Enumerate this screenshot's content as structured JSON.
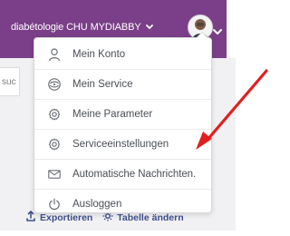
{
  "header": {
    "org_label": "diabétologie CHU MYDIABBY",
    "org_chevron_icon": "chevron-down-icon",
    "avatar_icon": "avatar-icon",
    "avatar_chevron_icon": "chevron-down-icon",
    "background": "#7a3f88"
  },
  "search": {
    "fragment": "suc"
  },
  "menu": {
    "items": [
      {
        "label": "Mein Konto",
        "icon": "user-icon"
      },
      {
        "label": "Mein Service",
        "icon": "service-icon"
      },
      {
        "label": "Meine Parameter",
        "icon": "gear-icon"
      },
      {
        "label": "Serviceeinstellungen",
        "icon": "gear-icon"
      },
      {
        "label": "Automatische Nachrichten.",
        "icon": "mail-icon"
      },
      {
        "label": "Ausloggen",
        "icon": "power-icon"
      }
    ]
  },
  "actions": {
    "export_label": "Exportieren",
    "table_label": "Tabelle ändern",
    "accent": "#3f4f8e"
  },
  "annotation": {
    "arrow_color": "#e02020"
  }
}
